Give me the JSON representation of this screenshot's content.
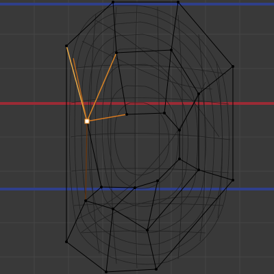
{
  "viewport": {
    "view": "3d-viewport",
    "mode": "edit-mode",
    "select_mode": "vertex",
    "background_color": "#393939",
    "grid_color": "#454545",
    "axis_x_color": "#9b2b35",
    "axis_blue_color": "#2f3f8a",
    "cage_wire_color": "#000000",
    "subdiv_wire_color": "#1a1a1a",
    "selected_vertex_color": "#ffffff",
    "selected_edge_color": "#ff9a2a",
    "selected_vertex_count": 1
  }
}
